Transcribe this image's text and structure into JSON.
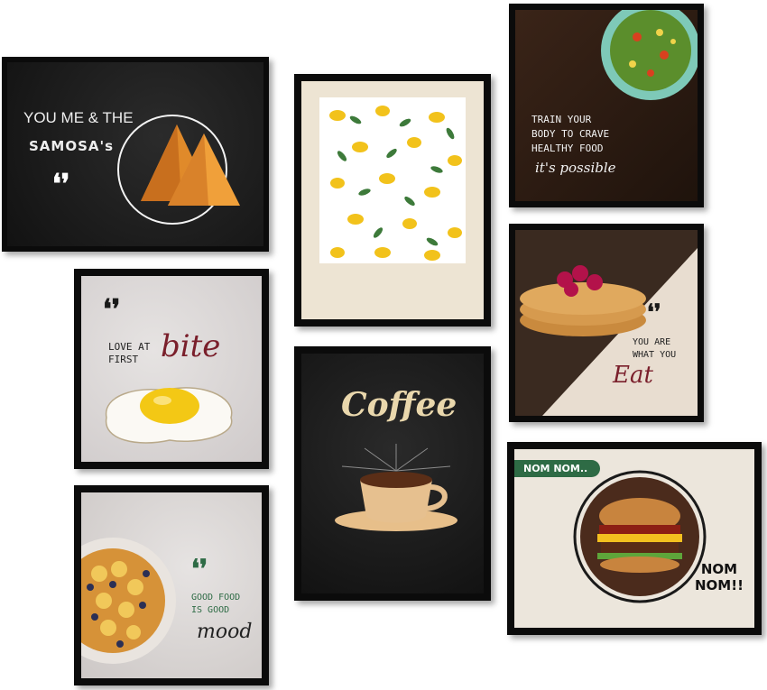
{
  "frames": {
    "samosa": {
      "line1": "YOU ME & THE",
      "line2": "SAMOSA's",
      "quote_mark": "❛❜"
    },
    "lemon": {},
    "salad": {
      "text": "TRAIN YOUR\nBODY TO CRAVE\nHEALTHY FOOD",
      "script": "it's possible"
    },
    "egg": {
      "text": "LOVE AT\nFIRST",
      "script": "bite",
      "quote_mark": "❛❜"
    },
    "coffee": {
      "title": "Coffee"
    },
    "pancake": {
      "text": "YOU ARE\nWHAT YOU",
      "script": "Eat",
      "quote_mark": "❛❜"
    },
    "burger": {
      "tag": "NOM NOM..",
      "text": "NOM\nNOM!!"
    },
    "banana": {
      "text": "GOOD FOOD\nIS GOOD",
      "script": "mood",
      "quote_mark": "❛❜"
    }
  },
  "colors": {
    "frame": "#0b0b0b",
    "accent_green": "#2e6b45",
    "accent_maroon": "#7a1f2b"
  }
}
